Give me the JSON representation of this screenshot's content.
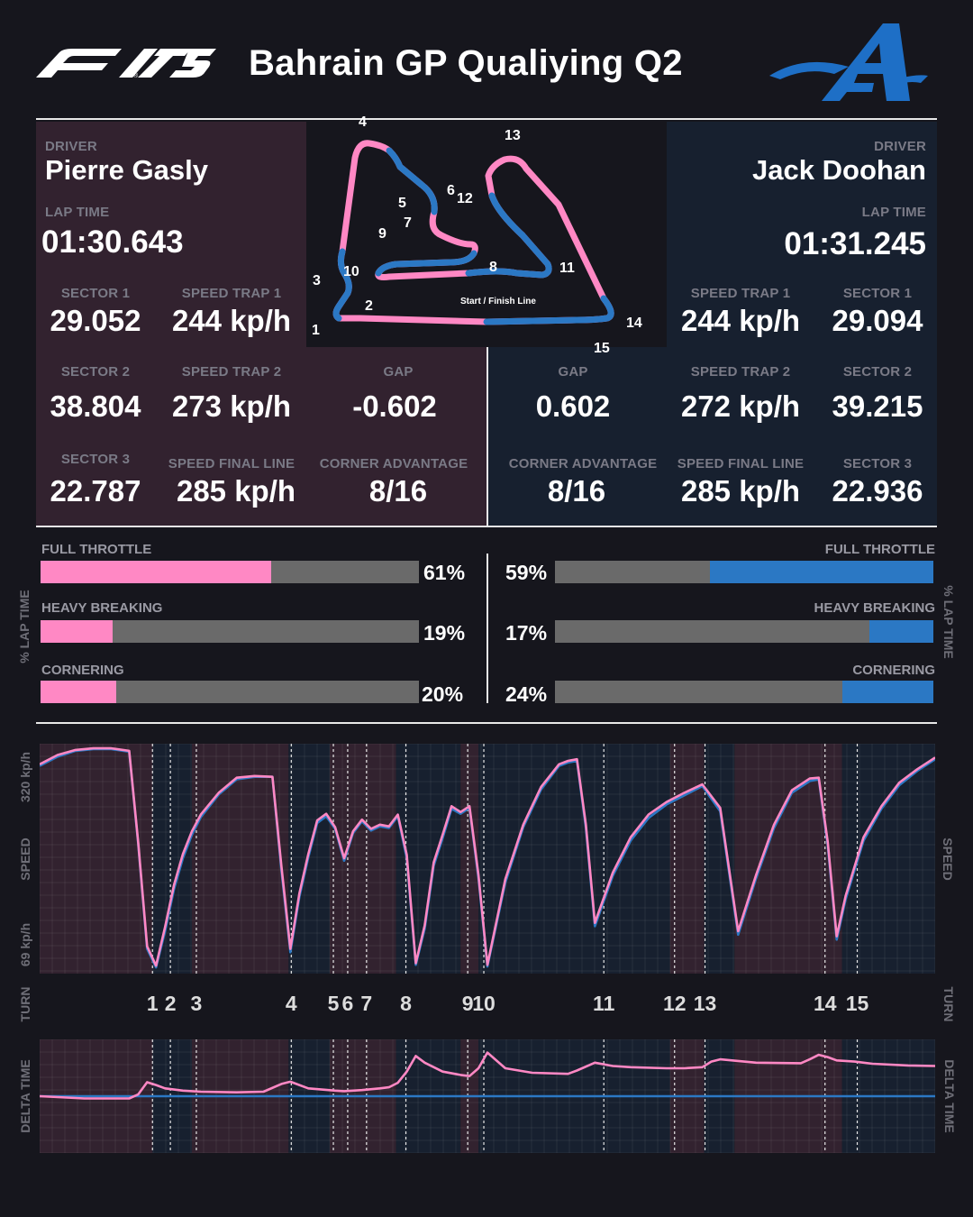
{
  "header": {
    "f1_logo": "F1 75",
    "title": "Bahrain GP Qualiying Q2",
    "team_logo": "A"
  },
  "colors": {
    "background": "#16161d",
    "gasly_panel": "#32222f",
    "doohan_panel": "#17202f",
    "gasly": "#ff88c4",
    "doohan": "#2b78c4",
    "bar_bg": "#6a6a6a"
  },
  "drivers": {
    "left": {
      "driver_label": "DRIVER",
      "name": "Pierre Gasly",
      "lap_time_label": "LAP TIME",
      "lap_time": "01:30.643",
      "sector1_label": "SECTOR 1",
      "sector1": "29.052",
      "speed_trap1_label": "SPEED TRAP 1",
      "speed_trap1": "244 kp/h",
      "sector2_label": "SECTOR 2",
      "sector2": "38.804",
      "speed_trap2_label": "SPEED TRAP 2",
      "speed_trap2": "273 kp/h",
      "gap_label": "GAP",
      "gap": "-0.602",
      "sector3_label": "SECTOR 3",
      "sector3": "22.787",
      "speed_final_label": "SPEED FINAL LINE",
      "speed_final": "285 kp/h",
      "corner_adv_label": "CORNER ADVANTAGE",
      "corner_adv": "8/16"
    },
    "right": {
      "driver_label": "DRIVER",
      "name": "Jack Doohan",
      "lap_time_label": "LAP TIME",
      "lap_time": "01:31.245",
      "sector1_label": "SECTOR 1",
      "sector1": "29.094",
      "speed_trap1_label": "SPEED TRAP 1",
      "speed_trap1": "244 kp/h",
      "sector2_label": "SECTOR 2",
      "sector2": "39.215",
      "speed_trap2_label": "SPEED TRAP 2",
      "speed_trap2": "272 kp/h",
      "gap_label": "GAP",
      "gap": "0.602",
      "sector3_label": "SECTOR 3",
      "sector3": "22.936",
      "speed_final_label": "SPEED FINAL LINE",
      "speed_final": "285 kp/h",
      "corner_adv_label": "CORNER ADVANTAGE",
      "corner_adv": "8/16"
    }
  },
  "track_map": {
    "start_finish_label": "Start / Finish Line",
    "turn_labels": [
      "1",
      "2",
      "3",
      "4",
      "5",
      "6",
      "7",
      "8",
      "9",
      "10",
      "11",
      "12",
      "13",
      "14",
      "15"
    ]
  },
  "lap_time_bars": {
    "axis_label": "% LAP TIME",
    "left": [
      {
        "label": "FULL THROTTLE",
        "value": 61,
        "text": "61%"
      },
      {
        "label": "HEAVY BREAKING",
        "value": 19,
        "text": "19%"
      },
      {
        "label": "CORNERING",
        "value": 20,
        "text": "20%"
      }
    ],
    "right": [
      {
        "label": "FULL THROTTLE",
        "value": 59,
        "text": "59%"
      },
      {
        "label": "HEAVY BREAKING",
        "value": 17,
        "text": "17%"
      },
      {
        "label": "CORNERING",
        "value": 24,
        "text": "24%"
      }
    ]
  },
  "axis_labels": {
    "speed": "SPEED",
    "speed_max": "320 kp/h",
    "speed_min": "69 kp/h",
    "turn": "TURN",
    "delta": "DELTA TIME"
  },
  "chart_data": [
    {
      "type": "line",
      "ylabel": "SPEED",
      "ylim": [
        69,
        330
      ],
      "x": [
        0,
        2,
        4,
        6,
        8,
        10,
        11,
        12,
        13,
        14,
        15,
        16,
        17,
        18,
        20,
        22,
        24,
        26,
        27,
        28,
        29,
        30,
        31,
        32,
        33,
        34,
        35,
        36,
        37,
        38,
        39,
        40,
        41,
        42,
        43,
        44,
        45,
        46,
        47,
        48,
        49,
        50,
        52,
        54,
        56,
        58,
        59,
        60,
        61,
        62,
        64,
        66,
        68,
        70,
        72,
        74,
        76,
        78,
        80,
        82,
        84,
        86,
        87,
        88,
        89,
        90,
        92,
        94,
        96,
        98,
        100
      ],
      "x_note": "distance in % of lap",
      "series": [
        {
          "name": "Pierre Gasly",
          "color": "#ff88c4",
          "values": [
            312,
            323,
            329,
            331,
            331,
            328,
            220,
            95,
            72,
            118,
            168,
            205,
            232,
            252,
            278,
            296,
            298,
            297,
            190,
            92,
            158,
            205,
            245,
            253,
            237,
            200,
            232,
            246,
            235,
            240,
            238,
            252,
            204,
            75,
            120,
            195,
            228,
            262,
            255,
            262,
            180,
            73,
            175,
            240,
            285,
            312,
            316,
            318,
            240,
            123,
            183,
            225,
            252,
            267,
            278,
            288,
            260,
            113,
            180,
            240,
            281,
            295,
            296,
            220,
            107,
            155,
            225,
            262,
            290,
            306,
            320
          ]
        },
        {
          "name": "Jack Doohan",
          "color": "#2b78c4",
          "values": [
            310,
            321,
            328,
            330,
            330,
            327,
            218,
            92,
            70,
            113,
            163,
            200,
            228,
            249,
            276,
            294,
            297,
            297,
            185,
            88,
            154,
            201,
            242,
            250,
            235,
            197,
            230,
            244,
            233,
            238,
            236,
            250,
            200,
            73,
            116,
            191,
            224,
            259,
            253,
            260,
            176,
            71,
            171,
            237,
            282,
            310,
            314,
            316,
            236,
            119,
            179,
            221,
            248,
            264,
            275,
            286,
            256,
            109,
            176,
            236,
            278,
            292,
            294,
            216,
            103,
            151,
            221,
            259,
            287,
            304,
            318
          ]
        }
      ]
    },
    {
      "type": "line",
      "ylabel": "DELTA TIME",
      "x": [
        0,
        5,
        10,
        11,
        12,
        13,
        14,
        16,
        18,
        22,
        25,
        27,
        28,
        29,
        30,
        33,
        34,
        36,
        38,
        39,
        40,
        41,
        42,
        43,
        45,
        47,
        48,
        49,
        50,
        52,
        55,
        59,
        60,
        62,
        64,
        66,
        70,
        72,
        74,
        75,
        76,
        80,
        85,
        86,
        87,
        88,
        89,
        91,
        93,
        97,
        100
      ],
      "series": [
        {
          "name": "Pierre Gasly",
          "color": "#ff88c4",
          "values": [
            0.0,
            -0.04,
            -0.04,
            0.03,
            0.25,
            0.2,
            0.14,
            0.1,
            0.08,
            0.07,
            0.08,
            0.22,
            0.26,
            0.2,
            0.14,
            0.1,
            0.09,
            0.11,
            0.14,
            0.16,
            0.24,
            0.44,
            0.72,
            0.6,
            0.44,
            0.38,
            0.36,
            0.5,
            0.78,
            0.5,
            0.42,
            0.4,
            0.46,
            0.6,
            0.54,
            0.52,
            0.5,
            0.5,
            0.52,
            0.62,
            0.66,
            0.6,
            0.59,
            0.66,
            0.74,
            0.7,
            0.64,
            0.62,
            0.58,
            0.55,
            0.54
          ]
        },
        {
          "name": "Jack Doohan",
          "color": "#2b78c4",
          "values": [
            0,
            0,
            0,
            0,
            0,
            0,
            0,
            0,
            0,
            0,
            0,
            0,
            0,
            0,
            0,
            0,
            0,
            0,
            0,
            0,
            0,
            0,
            0,
            0,
            0,
            0,
            0,
            0,
            0,
            0,
            0,
            0,
            0,
            0,
            0,
            0,
            0,
            0,
            0,
            0,
            0,
            0,
            0,
            0,
            0,
            0,
            0,
            0,
            0,
            0,
            0
          ]
        }
      ]
    }
  ],
  "turns": [
    {
      "label": "1",
      "pos": 12.6
    },
    {
      "label": "2",
      "pos": 14.6
    },
    {
      "label": "3",
      "pos": 17.5
    },
    {
      "label": "4",
      "pos": 28.1
    },
    {
      "label": "5",
      "pos": 32.8
    },
    {
      "label": "6",
      "pos": 34.4
    },
    {
      "label": "7",
      "pos": 36.5
    },
    {
      "label": "8",
      "pos": 40.9
    },
    {
      "label": "9",
      "pos": 47.8
    },
    {
      "label": "10",
      "pos": 49.6
    },
    {
      "label": "11",
      "pos": 63.0
    },
    {
      "label": "12",
      "pos": 70.9
    },
    {
      "label": "13",
      "pos": 74.3
    },
    {
      "label": "14",
      "pos": 87.7
    },
    {
      "label": "15",
      "pos": 91.3
    }
  ],
  "sector_bands": [
    {
      "from": 0,
      "to": 12.6,
      "driver": "gasly"
    },
    {
      "from": 12.6,
      "to": 17.0,
      "driver": "doohan"
    },
    {
      "from": 17.0,
      "to": 27.8,
      "driver": "gasly"
    },
    {
      "from": 27.8,
      "to": 32.4,
      "driver": "doohan"
    },
    {
      "from": 32.4,
      "to": 39.8,
      "driver": "gasly"
    },
    {
      "from": 39.8,
      "to": 47.0,
      "driver": "doohan"
    },
    {
      "from": 47.0,
      "to": 49.0,
      "driver": "gasly"
    },
    {
      "from": 49.0,
      "to": 70.4,
      "driver": "doohan"
    },
    {
      "from": 70.4,
      "to": 74.2,
      "driver": "gasly"
    },
    {
      "from": 74.2,
      "to": 77.6,
      "driver": "doohan"
    },
    {
      "from": 77.6,
      "to": 89.6,
      "driver": "gasly"
    },
    {
      "from": 89.6,
      "to": 100,
      "driver": "doohan"
    }
  ]
}
